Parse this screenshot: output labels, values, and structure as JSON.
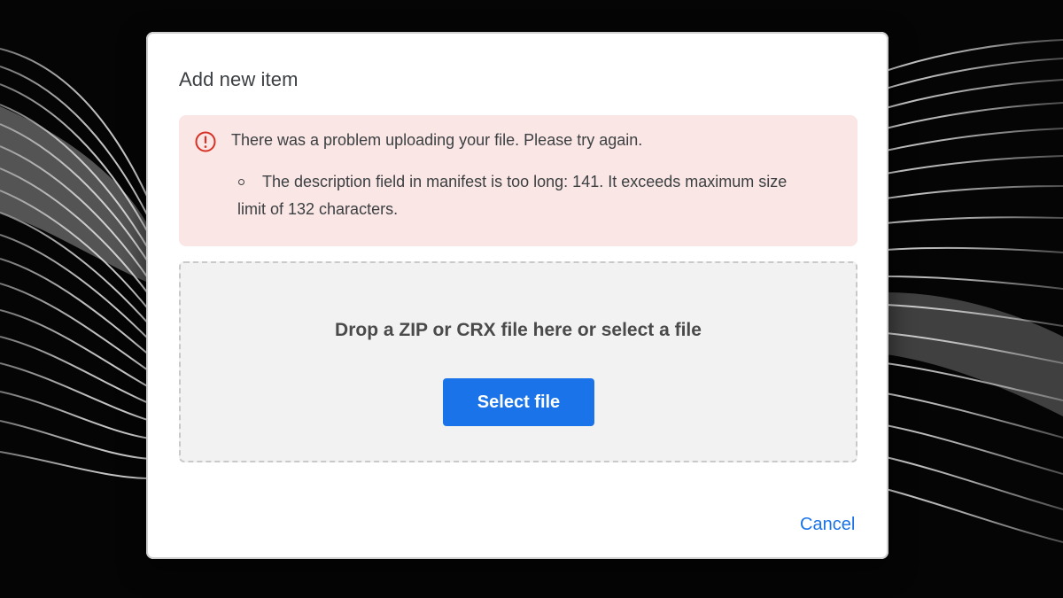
{
  "dialog": {
    "title": "Add new item",
    "error": {
      "icon": "error-circle-icon",
      "heading": "There was a problem uploading your file. Please try again.",
      "details": [
        "The description field in manifest is too long: 141. It exceeds maximum size limit of 132 characters."
      ]
    },
    "dropzone": {
      "prompt": "Drop a ZIP or CRX file here or select a file",
      "select_label": "Select file"
    },
    "cancel_label": "Cancel"
  },
  "colors": {
    "accent": "#1a73e8",
    "error_bg": "#fae6e4",
    "error_icon": "#d93025",
    "dropzone_bg": "#f2f2f2"
  }
}
